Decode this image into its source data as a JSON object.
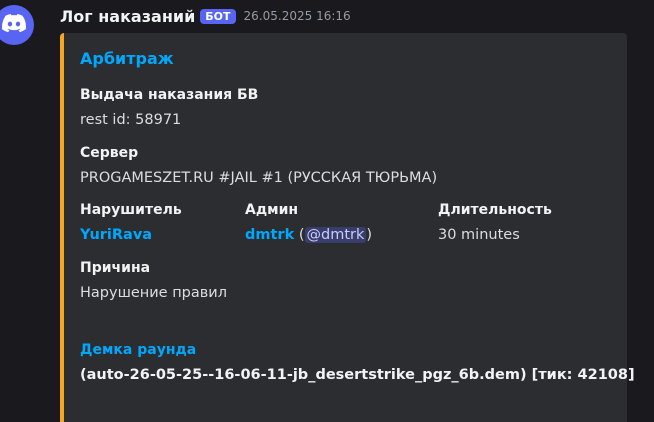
{
  "message": {
    "author": "Лог наказаний",
    "badge": "БОТ",
    "timestamp": "26.05.2025 16:16",
    "avatar_icon": "discord-logo-icon"
  },
  "embed": {
    "accent_color": "#f5a623",
    "title": "Арбитраж",
    "fields": {
      "punishment": {
        "name": "Выдача наказания БВ",
        "value": "rest id: 58971"
      },
      "server": {
        "name": "Сервер",
        "value": "PROGAMESZET.RU #JAIL #1 (РУССКАЯ ТЮРЬМА)"
      },
      "offender": {
        "name": "Нарушитель",
        "value": "YuriRava"
      },
      "admin": {
        "name": "Админ",
        "user": "dmtrk",
        "open_paren": " (",
        "mention": "@dmtrk",
        "close_paren": ")"
      },
      "duration": {
        "name": "Длительность",
        "value": "30 minutes"
      },
      "reason": {
        "name": "Причина",
        "value": "Нарушение правил"
      },
      "demo": {
        "name": "Демка раунда",
        "value": "(auto-26-05-25--16-06-11-jb_desertstrike_pgz_6b.dem) [тик: 42108]"
      }
    }
  }
}
